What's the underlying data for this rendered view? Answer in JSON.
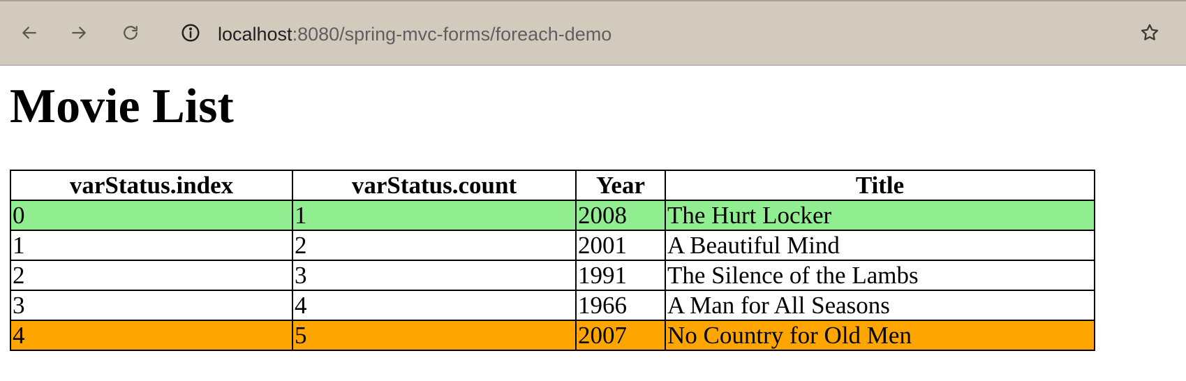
{
  "browser": {
    "url_host": "localhost",
    "url_rest": ":8080/spring-mvc-forms/foreach-demo",
    "icons": {
      "back": "arrow-left-icon",
      "forward": "arrow-right-icon",
      "reload": "reload-icon",
      "info": "info-icon",
      "bookmark": "star-icon"
    }
  },
  "page": {
    "title": "Movie List"
  },
  "table": {
    "headers": [
      "varStatus.index",
      "varStatus.count",
      "Year",
      "Title"
    ],
    "rows": [
      {
        "index": "0",
        "count": "1",
        "year": "2008",
        "title": "The Hurt Locker",
        "bg": "#90ee90"
      },
      {
        "index": "1",
        "count": "2",
        "year": "2001",
        "title": "A Beautiful Mind",
        "bg": "#ffffff"
      },
      {
        "index": "2",
        "count": "3",
        "year": "1991",
        "title": "The Silence of the Lambs",
        "bg": "#ffffff"
      },
      {
        "index": "3",
        "count": "4",
        "year": "1966",
        "title": "A Man for All Seasons",
        "bg": "#ffffff"
      },
      {
        "index": "4",
        "count": "5",
        "year": "2007",
        "title": "No Country for Old Men",
        "bg": "#ffa500"
      }
    ]
  }
}
